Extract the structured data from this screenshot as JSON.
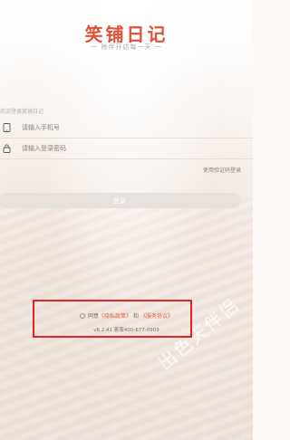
{
  "app": {
    "title": "笑铺日记",
    "tagline": "一 除伴开店每一天 一"
  },
  "login": {
    "welcome": "欢迎登录笑铺日记",
    "phone_placeholder": "请输入手机号",
    "password_placeholder": "请输入登录密码",
    "sms_login_label": "使用验证码登录",
    "login_button_label": "登录",
    "phone_icon": "phone-icon",
    "lock_icon": "lock-icon"
  },
  "agreement": {
    "prefix": "同意",
    "privacy_label": "《隐私政策》",
    "and_label": "和",
    "service_label": "《服务协议》"
  },
  "footer": {
    "version_text": "v6.2.41 客服400-677-0909"
  },
  "watermark": {
    "text": "出色天伴侣"
  },
  "colors": {
    "brand": "#e0513b",
    "link": "#e0613f",
    "highlight_box": "#e02323"
  }
}
